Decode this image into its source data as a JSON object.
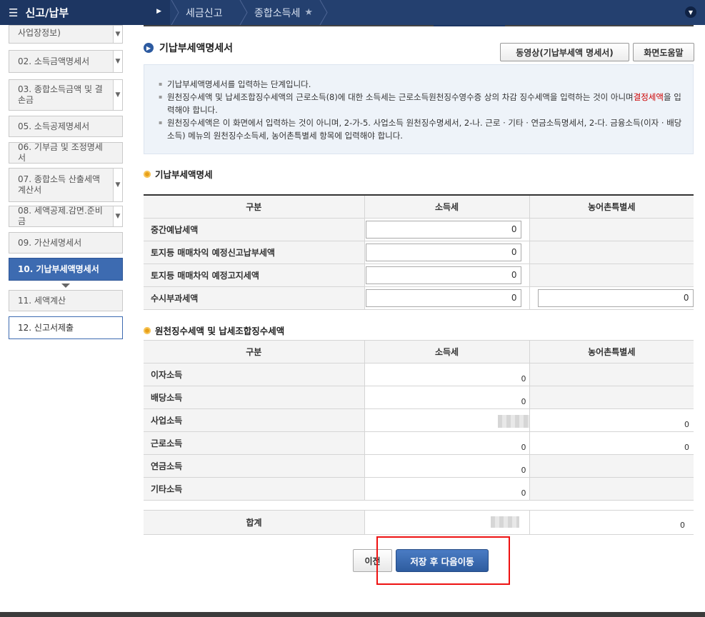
{
  "topbar": {
    "menu_title": "신고/납부",
    "breadcrumb": [
      "세금신고",
      "종합소득세"
    ]
  },
  "sidebar": {
    "items": [
      {
        "label": "사업장정보)",
        "state": "default",
        "chevron": true
      },
      {
        "label": "02.  소득금액명세서",
        "state": "default",
        "chevron": true
      },
      {
        "label": "03.  종합소득금액 및 결손금",
        "state": "default",
        "chevron": true
      },
      {
        "label": "05.  소득공제명세서",
        "state": "default",
        "chevron": false
      },
      {
        "label": "06.  기부금 및 조정명세서",
        "state": "default",
        "chevron": false
      },
      {
        "label": "07.  종합소득 산출세액계산서",
        "state": "default",
        "chevron": true
      },
      {
        "label": "08.  세액공제.감면.준비금",
        "state": "default",
        "chevron": true
      },
      {
        "label": "09.  가산세명세서",
        "state": "default",
        "chevron": false
      },
      {
        "label": "10.  기납부세액명세서",
        "state": "active",
        "chevron": false
      },
      {
        "label": "11.  세액계산",
        "state": "default",
        "chevron": false
      },
      {
        "label": "12.  신고서제출",
        "state": "white",
        "chevron": false
      }
    ]
  },
  "main": {
    "title": "기납부세액명세서",
    "video_button": "동영상(기납부세액 명세서)",
    "help_button": "화면도움말",
    "notice": {
      "line1": "기납부세액명세서를 입력하는 단계입니다.",
      "line2a": "원천징수세액 및 납세조합징수세액의 근로소득(8)에 대한 소득세는 근로소득원천징수영수증 상의 차감 징수세액을 입력하는 것이 아니며",
      "line2_red": "결정세액",
      "line2b": "을 입력해야 합니다.",
      "line3": "원천징수세액은 이 화면에서 입력하는 것이 아니며, 2-가-5. 사업소득 원천징수명세서, 2-나. 근로 · 기타 · 연금소득명세서, 2-다. 금융소득(이자 · 배당소득) 메뉴의 원천징수소득세, 농어촌특별세 항목에 입력해야 합니다."
    },
    "section1": {
      "title": "기납부세액명세",
      "headers": [
        "구분",
        "소득세",
        "농어촌특별세"
      ],
      "rows": [
        {
          "label": "중간예납세액",
          "income_tax": "0",
          "rural_tax": null
        },
        {
          "label": "토지등 매매차익 예정신고납부세액",
          "income_tax": "0",
          "rural_tax": null
        },
        {
          "label": "토지등 매매차익 예정고지세액",
          "income_tax": "0",
          "rural_tax": null
        },
        {
          "label": "수시부과세액",
          "income_tax": "0",
          "rural_tax": "0"
        }
      ]
    },
    "section2": {
      "title": "원천징수세액 및 납세조합징수세액",
      "headers": [
        "구분",
        "소득세",
        "농어촌특별세"
      ],
      "rows": [
        {
          "label": "이자소득",
          "income_tax": "0",
          "rural_tax": ""
        },
        {
          "label": "배당소득",
          "income_tax": "0",
          "rural_tax": ""
        },
        {
          "label": "사업소득",
          "income_tax": "",
          "rural_tax": "0"
        },
        {
          "label": "근로소득",
          "income_tax": "0",
          "rural_tax": "0"
        },
        {
          "label": "연금소득",
          "income_tax": "0",
          "rural_tax": ""
        },
        {
          "label": "기타소득",
          "income_tax": "0",
          "rural_tax": ""
        }
      ],
      "total_label": "합계",
      "total_rural": "0"
    },
    "prev_button": "이전",
    "next_button": "저장 후 다음이동"
  }
}
